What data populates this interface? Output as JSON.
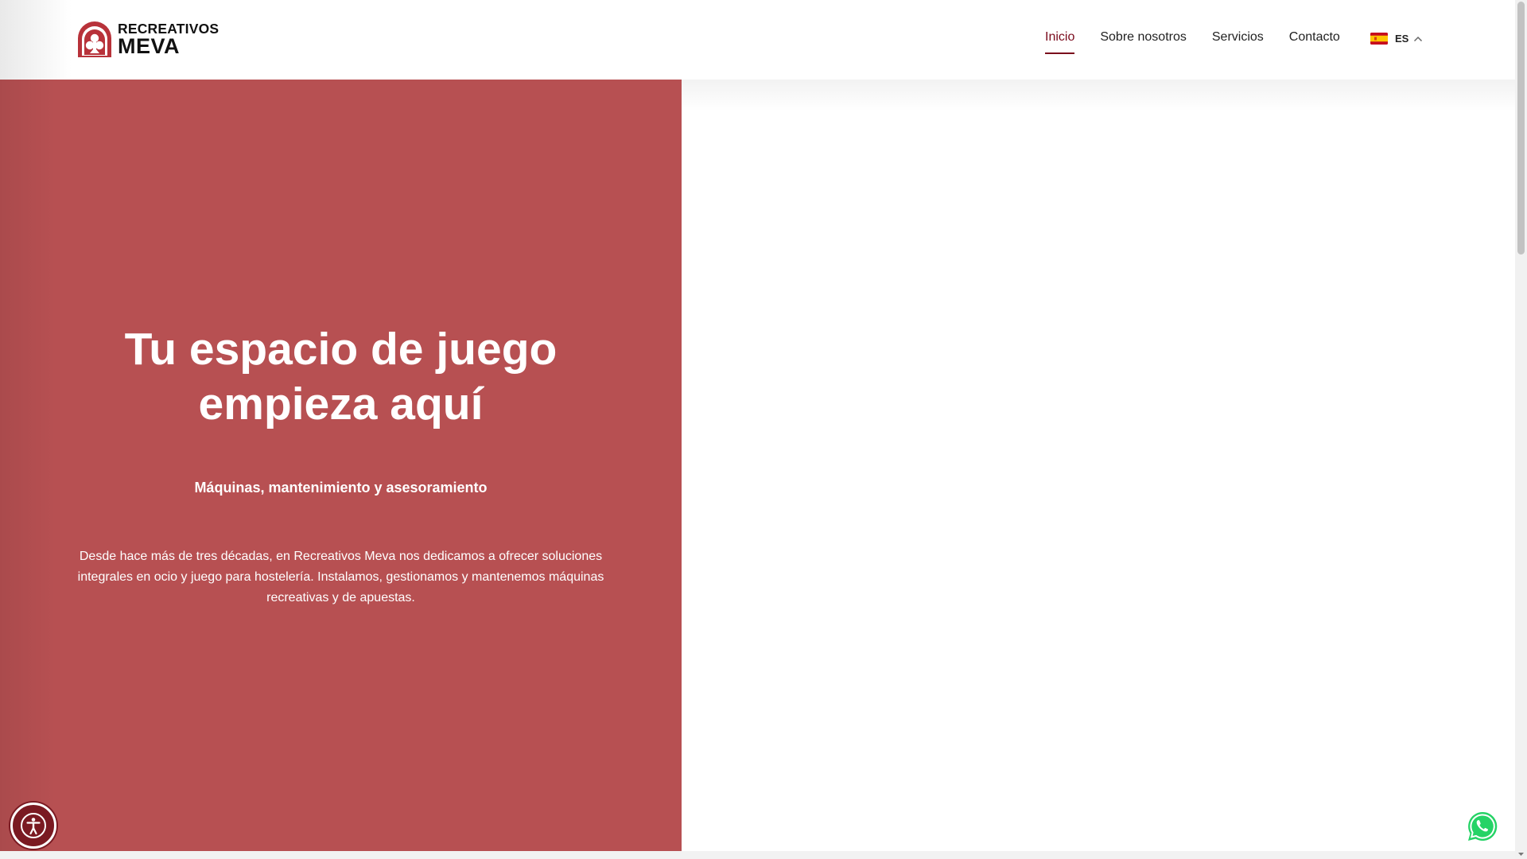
{
  "header": {
    "logo": {
      "line1": "RECREATIVOS",
      "line2": "MEVA",
      "icon": "club-arch-logo-icon",
      "accent_color": "#b8323a"
    },
    "nav": [
      {
        "label": "Inicio",
        "active": true
      },
      {
        "label": "Sobre nosotros",
        "active": false
      },
      {
        "label": "Servicios",
        "active": false
      },
      {
        "label": "Contacto",
        "active": false
      }
    ],
    "language": {
      "label": "ES",
      "flag_icon": "spain-flag-icon",
      "caret_icon": "chevron-up-icon"
    },
    "active_color": "#7a0a1c"
  },
  "hero": {
    "title": "Tu espacio de juego empieza aquí",
    "subtitle": "Máquinas, mantenimiento y asesoramiento",
    "body": "Desde hace más de tres décadas, en Recreativos Meva nos dedicamos a ofrecer soluciones integrales en ocio y juego para hostelería. Instalamos, gestionamos y mantenemos máquinas recreativas y de apuestas.",
    "background_color": "#b75052"
  },
  "floating": {
    "accessibility_icon": "accessibility-icon",
    "whatsapp_icon": "whatsapp-icon"
  }
}
